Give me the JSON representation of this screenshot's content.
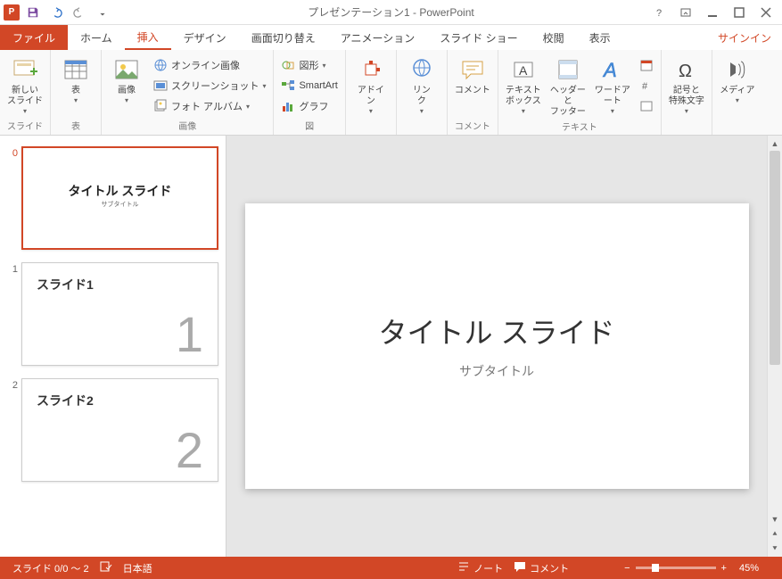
{
  "titlebar": {
    "title": "プレゼンテーション1 - PowerPoint",
    "app_initial": "P"
  },
  "tabs": {
    "file": "ファイル",
    "home": "ホーム",
    "insert": "挿入",
    "design": "デザイン",
    "transitions": "画面切り替え",
    "animations": "アニメーション",
    "slideshow": "スライド ショー",
    "review": "校閲",
    "view": "表示",
    "signin": "サインイン"
  },
  "ribbon": {
    "slides": {
      "new_slide": "新しい\nスライド",
      "group": "スライド"
    },
    "tables": {
      "table": "表",
      "group": "表"
    },
    "images": {
      "pictures": "画像",
      "online": "オンライン画像",
      "screenshot": "スクリーンショット",
      "album": "フォト アルバム",
      "group": "画像"
    },
    "illus": {
      "shapes": "図形",
      "smartart": "SmartArt",
      "chart": "グラフ",
      "group": "図"
    },
    "addins": {
      "addins": "アドイ\nン",
      "group": ""
    },
    "links": {
      "link": "リン\nク",
      "group": ""
    },
    "comments": {
      "comment": "コメント",
      "group": "コメント"
    },
    "text": {
      "textbox": "テキスト\nボックス",
      "headerfooter": "ヘッダーと\nフッター",
      "wordart": "ワードアート",
      "group": "テキスト"
    },
    "symbols": {
      "symbol": "記号と\n特殊文字",
      "group": ""
    },
    "media": {
      "media": "メディア",
      "group": ""
    }
  },
  "thumbs": [
    {
      "num": "0",
      "title": "タイトル スライド",
      "sub": "サブタイトル",
      "selected": true
    },
    {
      "num": "1",
      "left": "スライド1",
      "bignum": "1"
    },
    {
      "num": "2",
      "left": "スライド2",
      "bignum": "2"
    }
  ],
  "canvas": {
    "title": "タイトル スライド",
    "subtitle": "サブタイトル"
  },
  "status": {
    "slide": "スライド 0/0 ～ 2",
    "lang": "日本語",
    "notes": "ノート",
    "comments": "コメント",
    "zoom": "45%"
  }
}
